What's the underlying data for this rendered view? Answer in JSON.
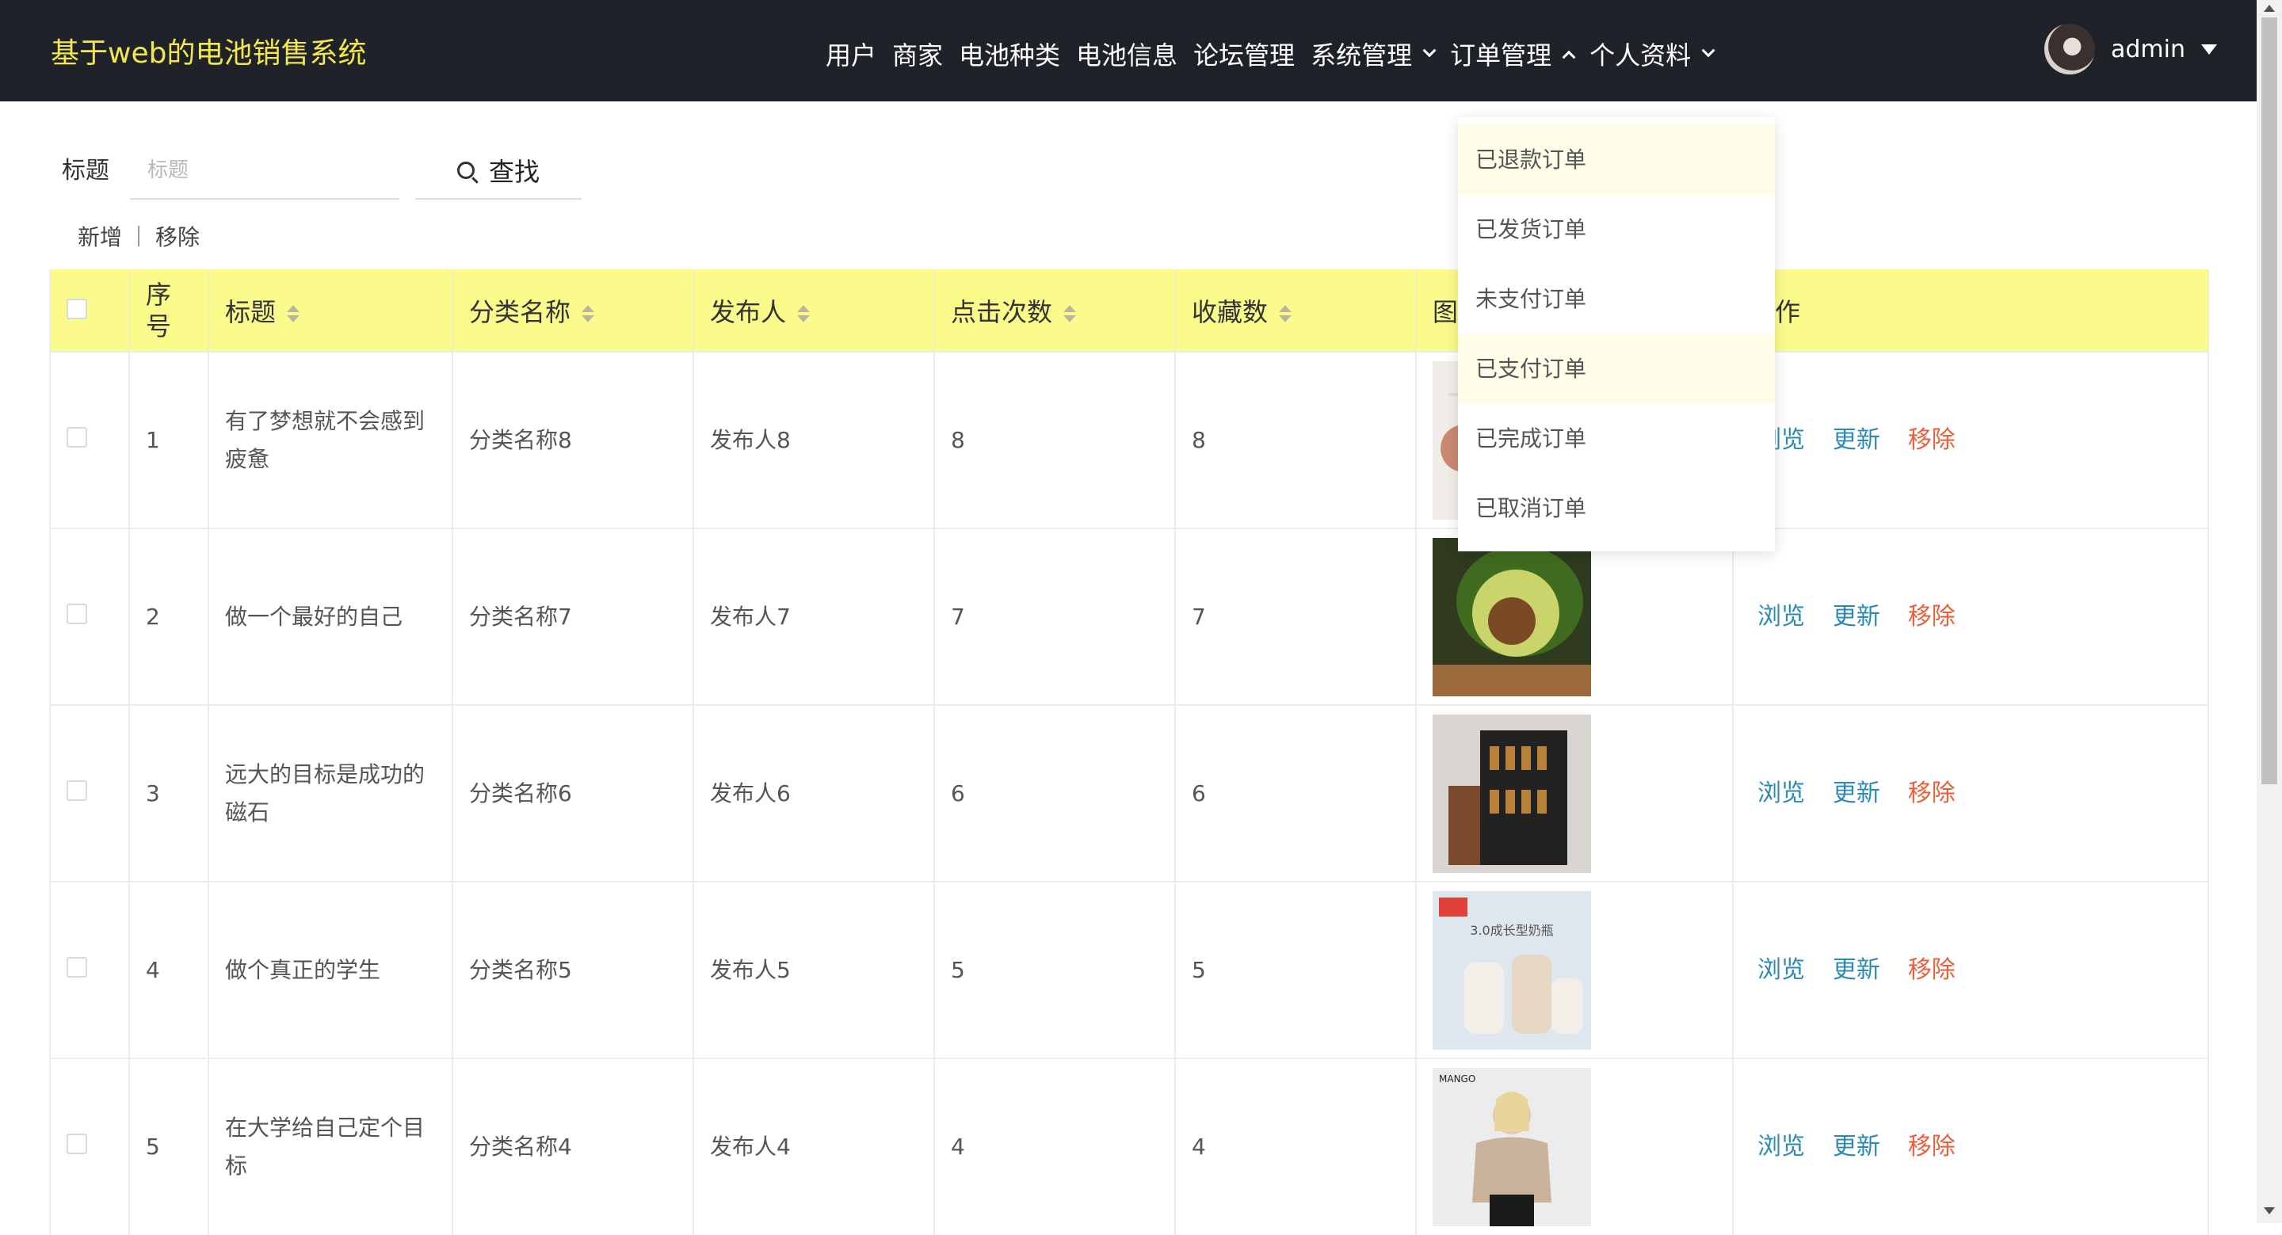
{
  "header": {
    "brand": "基于web的电池销售系统",
    "nav": [
      {
        "label": "用户",
        "caret": ""
      },
      {
        "label": "商家",
        "caret": ""
      },
      {
        "label": "电池种类",
        "caret": ""
      },
      {
        "label": "电池信息",
        "caret": ""
      },
      {
        "label": "论坛管理",
        "caret": ""
      },
      {
        "label": "系统管理",
        "caret": "down"
      },
      {
        "label": "订单管理",
        "caret": "up"
      },
      {
        "label": "个人资料",
        "caret": "down"
      }
    ],
    "user": {
      "name": "admin",
      "avatar_icon": "avatar-icon"
    }
  },
  "search": {
    "label": "标题",
    "placeholder": "标题",
    "value": "",
    "button_label": "查找",
    "button_icon": "search-icon"
  },
  "toolbar": {
    "add_label": "新增",
    "remove_label": "移除"
  },
  "table": {
    "columns": [
      "序号",
      "标题",
      "分类名称",
      "发布人",
      "点击次数",
      "收藏数",
      "图片",
      "操作"
    ],
    "rows": [
      {
        "index": "1",
        "title": "有了梦想就不会感到疲惫",
        "category": "分类名称8",
        "publisher": "发布人8",
        "clicks": "8",
        "favorites": "8",
        "image": "product-image"
      },
      {
        "index": "2",
        "title": "做一个最好的自己",
        "category": "分类名称7",
        "publisher": "发布人7",
        "clicks": "7",
        "favorites": "7",
        "image": "avocado-image"
      },
      {
        "index": "3",
        "title": "远大的目标是成功的磁石",
        "category": "分类名称6",
        "publisher": "发布人6",
        "clicks": "6",
        "favorites": "6",
        "image": "spice-rack-image"
      },
      {
        "index": "4",
        "title": "做个真正的学生",
        "category": "分类名称5",
        "publisher": "发布人5",
        "clicks": "5",
        "favorites": "5",
        "image": "baby-bottle-image",
        "image_caption": "3.0成长型奶瓶"
      },
      {
        "index": "5",
        "title": "在大学给自己定个目标",
        "category": "分类名称4",
        "publisher": "发布人4",
        "clicks": "4",
        "favorites": "4",
        "image": "fashion-model-image",
        "image_caption": "MANGO"
      }
    ],
    "ops": {
      "view": "浏览",
      "edit": "更新",
      "delete": "移除"
    }
  },
  "order_menu": {
    "items": [
      "已退款订单",
      "已发货订单",
      "未支付订单",
      "已支付订单",
      "已完成订单",
      "已取消订单"
    ],
    "highlighted": [
      0,
      3
    ]
  },
  "colors": {
    "header_bg": "#1f2229",
    "brand": "#f2e84d",
    "table_header": "#fbfb8c",
    "link": "#2b8ab4",
    "danger": "#e8603c"
  }
}
